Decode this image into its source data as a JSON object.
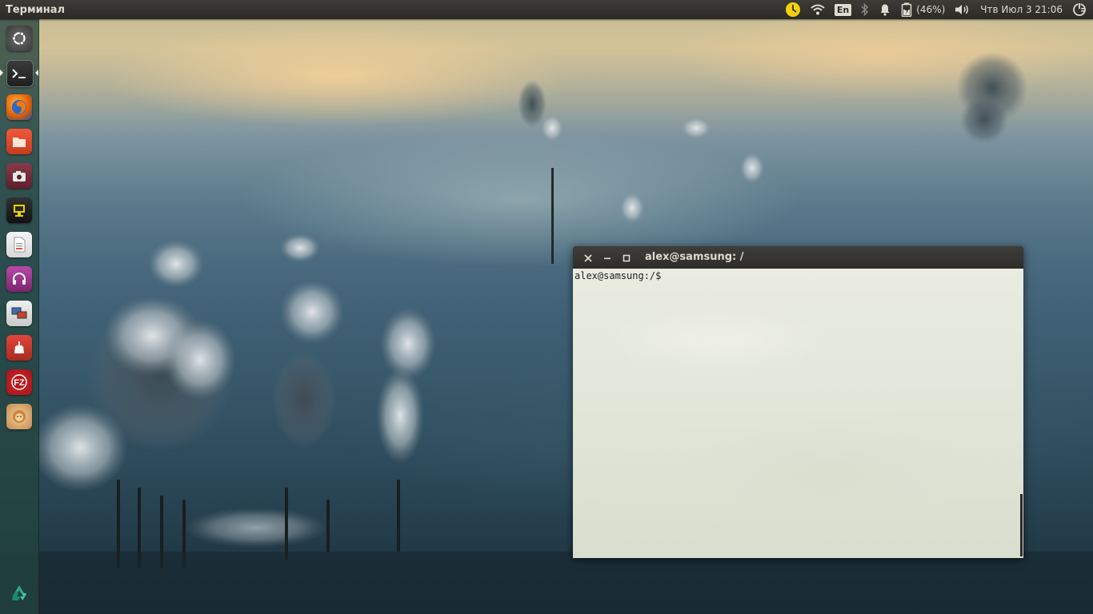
{
  "top_panel": {
    "title": "Терминал",
    "language": "En",
    "battery_text": "(46%)",
    "datetime": "Чтв Июл  3 21:06"
  },
  "launcher": {
    "items": [
      {
        "name": "dash-home",
        "icon": "ubuntu-logo-icon"
      },
      {
        "name": "terminal",
        "icon": "terminal-icon"
      },
      {
        "name": "firefox",
        "icon": "firefox-icon"
      },
      {
        "name": "files",
        "icon": "folder-icon"
      },
      {
        "name": "screenshot",
        "icon": "camera-icon"
      },
      {
        "name": "remote-desktop",
        "icon": "monitor-icon"
      },
      {
        "name": "text-editor",
        "icon": "document-icon"
      },
      {
        "name": "audio-player",
        "icon": "headphones-icon"
      },
      {
        "name": "remote-viewer",
        "icon": "screens-icon"
      },
      {
        "name": "software-installer",
        "icon": "install-icon"
      },
      {
        "name": "filezilla",
        "icon": "filezilla-icon"
      },
      {
        "name": "app-lazarus",
        "icon": "lion-icon"
      },
      {
        "name": "trash",
        "icon": "recycle-icon"
      }
    ]
  },
  "terminal": {
    "title": "alex@samsung: /",
    "prompt": "alex@samsung:/$"
  },
  "colors": {
    "panel_bg": "#2b2a27",
    "panel_text": "#dfdbd2",
    "launcher_bg": "#22443e",
    "terminal_bg": "#f0f0e2"
  }
}
